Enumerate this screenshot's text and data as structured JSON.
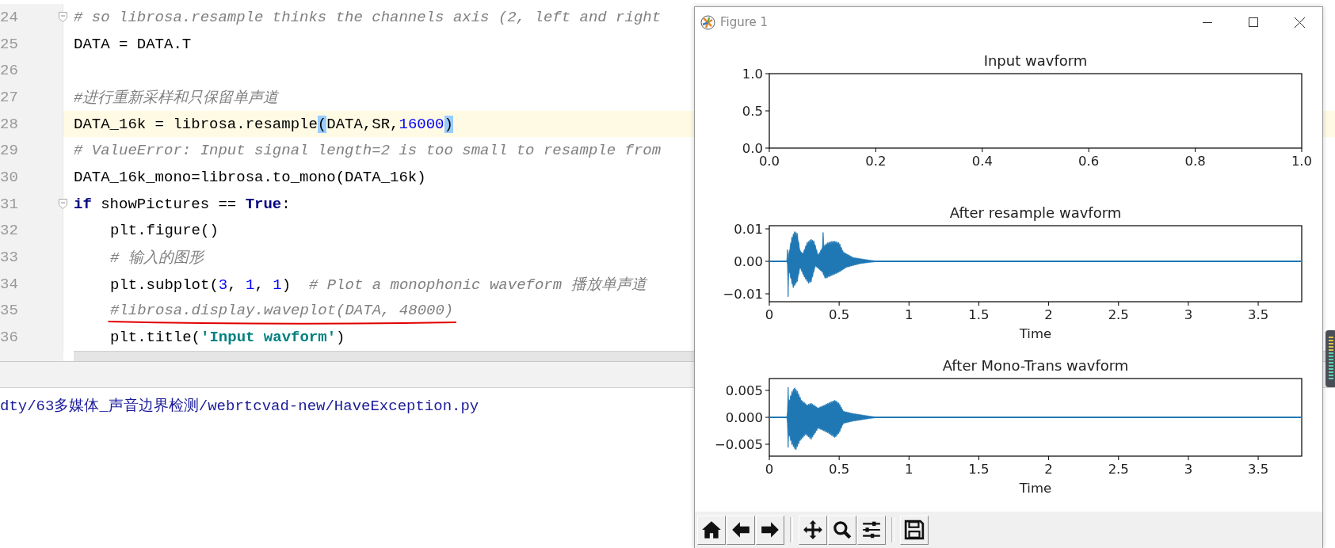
{
  "editor": {
    "lines": [
      {
        "number": "24",
        "fold": true,
        "current": false,
        "indented": false,
        "annotated": false,
        "tokens": [
          {
            "kind": "comment",
            "text": "# so librosa.resample thinks the channels axis (2, left and right"
          }
        ]
      },
      {
        "number": "25",
        "fold": false,
        "current": false,
        "indented": false,
        "annotated": false,
        "tokens": [
          {
            "kind": "plain",
            "text": "DATA = DATA.T"
          }
        ]
      },
      {
        "number": "26",
        "fold": false,
        "current": false
      },
      {
        "number": "27",
        "fold": false,
        "current": false,
        "indented": false,
        "annotated": false,
        "tokens": [
          {
            "kind": "comment",
            "text": "#进行重新采样和只保留单声道"
          }
        ]
      },
      {
        "number": "28",
        "fold": false,
        "current": true,
        "indented": false,
        "annotated": false,
        "tokens": [
          {
            "kind": "plain",
            "text": "DATA_16k = librosa.resample"
          },
          {
            "kind": "match",
            "text": "("
          },
          {
            "kind": "plain",
            "text": "DATA,SR,"
          },
          {
            "kind": "number",
            "text": "16000"
          },
          {
            "kind": "match",
            "text": ")"
          }
        ]
      },
      {
        "number": "29",
        "fold": false,
        "current": false,
        "indented": false,
        "annotated": false,
        "tokens": [
          {
            "kind": "comment",
            "text": "# ValueError: Input signal length=2 is too small to resample from"
          }
        ]
      },
      {
        "number": "30",
        "fold": false,
        "current": false,
        "indented": false,
        "annotated": false,
        "tokens": [
          {
            "kind": "plain",
            "text": "DATA_16k_mono=librosa.to_mono(DATA_16k)"
          }
        ]
      },
      {
        "number": "31",
        "fold": true,
        "current": false,
        "indented": false,
        "annotated": false,
        "tokens": [
          {
            "kind": "keyword",
            "text": "if"
          },
          {
            "kind": "plain",
            "text": " showPictures == "
          },
          {
            "kind": "keyword",
            "text": "True"
          },
          {
            "kind": "plain",
            "text": ":"
          }
        ]
      },
      {
        "number": "32",
        "fold": false,
        "current": false,
        "indented": true,
        "annotated": false,
        "tokens": [
          {
            "kind": "plain",
            "text": "plt.figure()"
          }
        ]
      },
      {
        "number": "33",
        "fold": false,
        "current": false,
        "indented": true,
        "annotated": false,
        "tokens": [
          {
            "kind": "comment",
            "text": "# 输入的图形"
          }
        ]
      },
      {
        "number": "34",
        "fold": false,
        "current": false,
        "indented": true,
        "annotated": false,
        "tokens": [
          {
            "kind": "plain",
            "text": "plt.subplot("
          },
          {
            "kind": "number",
            "text": "3"
          },
          {
            "kind": "plain",
            "text": ", "
          },
          {
            "kind": "number",
            "text": "1"
          },
          {
            "kind": "plain",
            "text": ", "
          },
          {
            "kind": "number",
            "text": "1"
          },
          {
            "kind": "plain",
            "text": ")  "
          },
          {
            "kind": "comment",
            "text": "# Plot a monophonic waveform 播放单声道"
          }
        ]
      },
      {
        "number": "35",
        "fold": false,
        "current": false,
        "indented": true,
        "annotated": true,
        "tokens": [
          {
            "kind": "comment",
            "text": "#librosa.display.waveplot(DATA, 48000)"
          }
        ]
      },
      {
        "number": "36",
        "fold": false,
        "current": false,
        "indented": true,
        "annotated": false,
        "tokens": [
          {
            "kind": "plain",
            "text": "plt.title("
          },
          {
            "kind": "string",
            "text": "'Input wavform'"
          },
          {
            "kind": "plain",
            "text": ")"
          }
        ]
      }
    ]
  },
  "output": {
    "path": "dty/63多媒体_声音边界检测/webrtcvad-new/HaveException.py"
  },
  "figure": {
    "title": "Figure 1",
    "subplots": [
      {
        "kind": "empty",
        "title": "Input wavform",
        "xticks": [
          "0.0",
          "0.2",
          "0.4",
          "0.6",
          "0.8",
          "1.0"
        ],
        "yticks": [
          "1.0",
          "0.5",
          "0.0"
        ]
      },
      {
        "kind": "waveform",
        "title": "After resample wavform",
        "xlabel": "Time",
        "xticks": [
          "0",
          "0.5",
          "1",
          "1.5",
          "2",
          "2.5",
          "3",
          "3.5"
        ],
        "yticks": [
          "0.01",
          "0.00",
          "−0.01"
        ]
      },
      {
        "kind": "waveform",
        "title": "After Mono-Trans wavform",
        "xlabel": "Time",
        "xticks": [
          "0",
          "0.5",
          "1",
          "1.5",
          "2",
          "2.5",
          "3",
          "3.5"
        ],
        "yticks": [
          "0.005",
          "0.000",
          "−0.005"
        ]
      }
    ],
    "toolbar": [
      {
        "kind": "home"
      },
      {
        "kind": "back"
      },
      {
        "kind": "forward"
      },
      {
        "kind": "separator"
      },
      {
        "kind": "pan"
      },
      {
        "kind": "zoom"
      },
      {
        "kind": "configure"
      },
      {
        "kind": "separator"
      },
      {
        "kind": "save"
      }
    ]
  }
}
